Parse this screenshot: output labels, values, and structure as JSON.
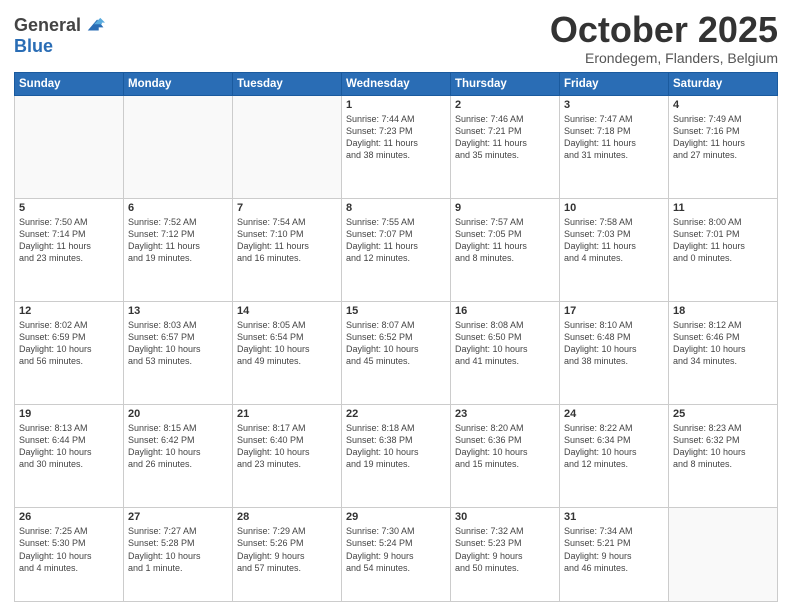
{
  "header": {
    "logo_line1": "General",
    "logo_line2": "Blue",
    "month": "October 2025",
    "location": "Erondegem, Flanders, Belgium"
  },
  "weekdays": [
    "Sunday",
    "Monday",
    "Tuesday",
    "Wednesday",
    "Thursday",
    "Friday",
    "Saturday"
  ],
  "weeks": [
    [
      {
        "day": "",
        "info": ""
      },
      {
        "day": "",
        "info": ""
      },
      {
        "day": "",
        "info": ""
      },
      {
        "day": "1",
        "info": "Sunrise: 7:44 AM\nSunset: 7:23 PM\nDaylight: 11 hours\nand 38 minutes."
      },
      {
        "day": "2",
        "info": "Sunrise: 7:46 AM\nSunset: 7:21 PM\nDaylight: 11 hours\nand 35 minutes."
      },
      {
        "day": "3",
        "info": "Sunrise: 7:47 AM\nSunset: 7:18 PM\nDaylight: 11 hours\nand 31 minutes."
      },
      {
        "day": "4",
        "info": "Sunrise: 7:49 AM\nSunset: 7:16 PM\nDaylight: 11 hours\nand 27 minutes."
      }
    ],
    [
      {
        "day": "5",
        "info": "Sunrise: 7:50 AM\nSunset: 7:14 PM\nDaylight: 11 hours\nand 23 minutes."
      },
      {
        "day": "6",
        "info": "Sunrise: 7:52 AM\nSunset: 7:12 PM\nDaylight: 11 hours\nand 19 minutes."
      },
      {
        "day": "7",
        "info": "Sunrise: 7:54 AM\nSunset: 7:10 PM\nDaylight: 11 hours\nand 16 minutes."
      },
      {
        "day": "8",
        "info": "Sunrise: 7:55 AM\nSunset: 7:07 PM\nDaylight: 11 hours\nand 12 minutes."
      },
      {
        "day": "9",
        "info": "Sunrise: 7:57 AM\nSunset: 7:05 PM\nDaylight: 11 hours\nand 8 minutes."
      },
      {
        "day": "10",
        "info": "Sunrise: 7:58 AM\nSunset: 7:03 PM\nDaylight: 11 hours\nand 4 minutes."
      },
      {
        "day": "11",
        "info": "Sunrise: 8:00 AM\nSunset: 7:01 PM\nDaylight: 11 hours\nand 0 minutes."
      }
    ],
    [
      {
        "day": "12",
        "info": "Sunrise: 8:02 AM\nSunset: 6:59 PM\nDaylight: 10 hours\nand 56 minutes."
      },
      {
        "day": "13",
        "info": "Sunrise: 8:03 AM\nSunset: 6:57 PM\nDaylight: 10 hours\nand 53 minutes."
      },
      {
        "day": "14",
        "info": "Sunrise: 8:05 AM\nSunset: 6:54 PM\nDaylight: 10 hours\nand 49 minutes."
      },
      {
        "day": "15",
        "info": "Sunrise: 8:07 AM\nSunset: 6:52 PM\nDaylight: 10 hours\nand 45 minutes."
      },
      {
        "day": "16",
        "info": "Sunrise: 8:08 AM\nSunset: 6:50 PM\nDaylight: 10 hours\nand 41 minutes."
      },
      {
        "day": "17",
        "info": "Sunrise: 8:10 AM\nSunset: 6:48 PM\nDaylight: 10 hours\nand 38 minutes."
      },
      {
        "day": "18",
        "info": "Sunrise: 8:12 AM\nSunset: 6:46 PM\nDaylight: 10 hours\nand 34 minutes."
      }
    ],
    [
      {
        "day": "19",
        "info": "Sunrise: 8:13 AM\nSunset: 6:44 PM\nDaylight: 10 hours\nand 30 minutes."
      },
      {
        "day": "20",
        "info": "Sunrise: 8:15 AM\nSunset: 6:42 PM\nDaylight: 10 hours\nand 26 minutes."
      },
      {
        "day": "21",
        "info": "Sunrise: 8:17 AM\nSunset: 6:40 PM\nDaylight: 10 hours\nand 23 minutes."
      },
      {
        "day": "22",
        "info": "Sunrise: 8:18 AM\nSunset: 6:38 PM\nDaylight: 10 hours\nand 19 minutes."
      },
      {
        "day": "23",
        "info": "Sunrise: 8:20 AM\nSunset: 6:36 PM\nDaylight: 10 hours\nand 15 minutes."
      },
      {
        "day": "24",
        "info": "Sunrise: 8:22 AM\nSunset: 6:34 PM\nDaylight: 10 hours\nand 12 minutes."
      },
      {
        "day": "25",
        "info": "Sunrise: 8:23 AM\nSunset: 6:32 PM\nDaylight: 10 hours\nand 8 minutes."
      }
    ],
    [
      {
        "day": "26",
        "info": "Sunrise: 7:25 AM\nSunset: 5:30 PM\nDaylight: 10 hours\nand 4 minutes."
      },
      {
        "day": "27",
        "info": "Sunrise: 7:27 AM\nSunset: 5:28 PM\nDaylight: 10 hours\nand 1 minute."
      },
      {
        "day": "28",
        "info": "Sunrise: 7:29 AM\nSunset: 5:26 PM\nDaylight: 9 hours\nand 57 minutes."
      },
      {
        "day": "29",
        "info": "Sunrise: 7:30 AM\nSunset: 5:24 PM\nDaylight: 9 hours\nand 54 minutes."
      },
      {
        "day": "30",
        "info": "Sunrise: 7:32 AM\nSunset: 5:23 PM\nDaylight: 9 hours\nand 50 minutes."
      },
      {
        "day": "31",
        "info": "Sunrise: 7:34 AM\nSunset: 5:21 PM\nDaylight: 9 hours\nand 46 minutes."
      },
      {
        "day": "",
        "info": ""
      }
    ]
  ]
}
